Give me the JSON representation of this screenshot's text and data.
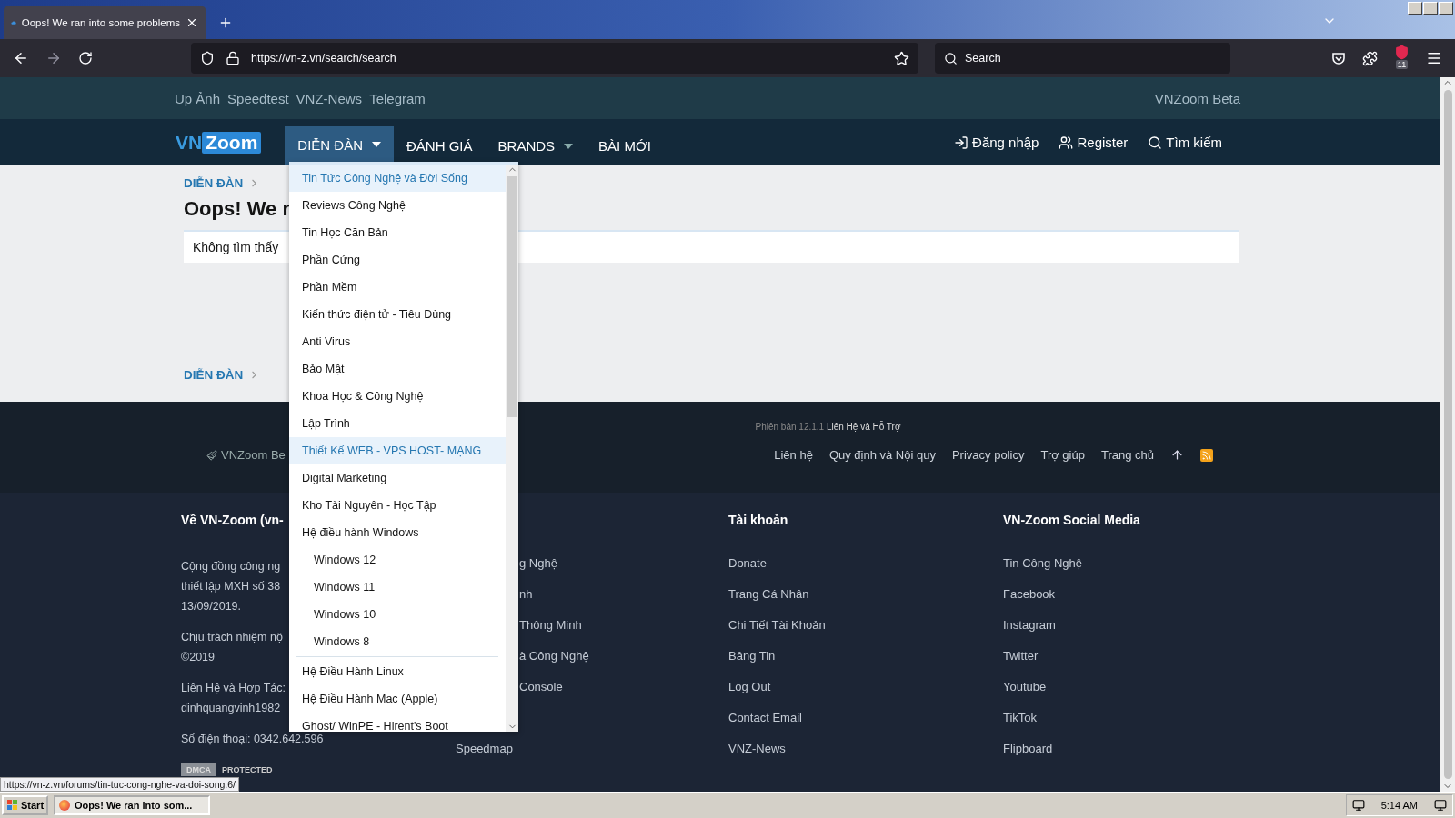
{
  "browser": {
    "tab_title": "Oops! We ran into some problems",
    "url": "https://vn-z.vn/search/search",
    "search_placeholder": "Search",
    "badge": "11"
  },
  "site": {
    "top_links": [
      "Up Ảnh",
      "Speedtest",
      "VNZ-News",
      "Telegram"
    ],
    "top_right": "VNZoom Beta",
    "logo": {
      "left": "VN",
      "right": "Zoom"
    },
    "nav": [
      {
        "label": "DIỄN ĐÀN",
        "selected": true,
        "caret": true
      },
      {
        "label": "ĐÁNH GIÁ",
        "selected": false,
        "caret": false
      },
      {
        "label": "BRANDS",
        "selected": false,
        "caret": true
      },
      {
        "label": "BÀI MỚI",
        "selected": false,
        "caret": false
      }
    ],
    "nav_right": [
      {
        "kind": "login",
        "label": "Đăng nhập"
      },
      {
        "kind": "register",
        "label": "Register"
      },
      {
        "kind": "search",
        "label": "Tìm kiếm"
      }
    ],
    "breadcrumb": "DIỄN ĐÀN",
    "title": "Oops! We r",
    "message": "Không tìm thấy",
    "breadcrumb_bottom": "DIỄN ĐÀN"
  },
  "dropdown": {
    "items": [
      {
        "label": "Tin Tức Công Nghệ và Đời Sống",
        "highlighted": true
      },
      {
        "label": "Reviews Công Nghệ",
        "highlighted": false
      },
      {
        "label": "Tin Học Căn Bản",
        "highlighted": false
      },
      {
        "label": "Phần Cứng",
        "highlighted": false
      },
      {
        "label": "Phần Mềm",
        "highlighted": false
      },
      {
        "label": "Kiến thức điện tử - Tiêu Dùng",
        "highlighted": false
      },
      {
        "label": "Anti Virus",
        "highlighted": false
      },
      {
        "label": "Bảo Mật",
        "highlighted": false
      },
      {
        "label": "Khoa Học & Công Nghệ",
        "highlighted": false
      },
      {
        "label": "Lập Trình",
        "highlighted": false
      },
      {
        "label": "Thiết Kế WEB - VPS HOST- MẠNG",
        "highlighted": true
      },
      {
        "label": "Digital Marketing",
        "highlighted": false
      },
      {
        "label": "Kho Tài Nguyên - Học Tập",
        "highlighted": false
      },
      {
        "label": "Hệ điều hành Windows",
        "highlighted": false,
        "children": [
          {
            "label": "Windows 12",
            "highlighted": false
          },
          {
            "label": "Windows 11",
            "highlighted": false
          },
          {
            "label": "Windows 10",
            "highlighted": false
          },
          {
            "label": "Windows 8",
            "highlighted": false
          }
        ]
      },
      {
        "label": "Hệ Điều Hành Linux",
        "highlighted": false
      },
      {
        "label": "Hệ Điều Hành Mac (Apple)",
        "highlighted": false
      },
      {
        "label": "Ghost/ WinPE - Hirent's Boot",
        "highlighted": false
      }
    ]
  },
  "footer": {
    "version": "Phiên bản 12.1.1",
    "support_link": "Liên Hệ và Hỗ Trợ",
    "style_link": "VNZoom Be",
    "links": [
      "Liên hệ",
      "Quy định và Nội quy",
      "Privacy policy",
      "Trợ giúp",
      "Trang chủ"
    ],
    "about": {
      "heading": "Về VN-Zoom (vn-",
      "paragraphs": [
        [
          "Cộng đồng công ng",
          "thiết lập MXH số 38",
          "13/09/2019."
        ],
        [
          "Chịu trách nhiệm nộ",
          "©2019"
        ],
        [
          "Liên Hệ và Hợp Tác:",
          "dinhquangvinh1982"
        ],
        [
          "Số điện thoại: 0342.642.596"
        ]
      ],
      "badge_left": "DMCA",
      "badge_right": "PROTECTED"
    },
    "middle": [
      {
        "label": "g Nghệ",
        "kind": "cut"
      },
      {
        "label": "nh",
        "kind": "cut"
      },
      {
        "label": "Thông Minh",
        "kind": "cut"
      },
      {
        "label": "à Công Nghệ",
        "kind": "cut"
      },
      {
        "label": "Console",
        "kind": "cut"
      },
      {
        "label": "Speedmap",
        "kind": "full"
      }
    ],
    "columns": [
      {
        "heading": "Tài khoản",
        "items": [
          "Donate",
          "Trang Cá Nhân",
          "Chi Tiết Tài Khoản",
          "Bảng Tin",
          "Log Out",
          "Contact Email",
          "VNZ-News"
        ]
      },
      {
        "heading": "VN-Zoom Social Media",
        "items": [
          "Tin Công Nghệ",
          "Facebook",
          "Instagram",
          "Twitter",
          "Youtube",
          "TikTok",
          "Flipboard"
        ]
      }
    ]
  },
  "status_url": "https://vn-z.vn/forums/tin-tuc-cong-nghe-va-doi-song.6/",
  "taskbar": {
    "start": "Start",
    "task": "Oops! We ran into som...",
    "clock": "5:14 AM"
  }
}
